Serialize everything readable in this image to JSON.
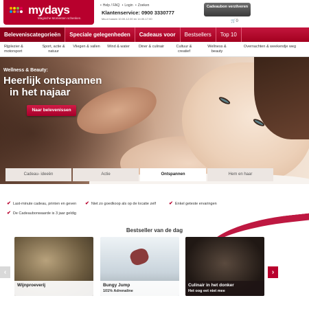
{
  "header": {
    "logo_text": "mydays",
    "logo_tagline": "Magische Momenten schenken.",
    "links": [
      "Help / FAQ",
      "Login",
      "Zoeken"
    ],
    "service_label": "Klantenservice: 0900 3330777",
    "hours": "Ma-vr tussen 10.00-12.00 en 14.00-17.00",
    "voucher_button": "Cadeaubon verzilveren",
    "cart_count": "0"
  },
  "mainnav": {
    "items": [
      {
        "label": "Beleveniscategorieën"
      },
      {
        "label": "Speciale gelegenheden"
      },
      {
        "label": "Cadeaus voor"
      },
      {
        "label": "Bestsellers"
      },
      {
        "label": "Top 10"
      }
    ]
  },
  "subnav": {
    "items": [
      {
        "label": "Rijplezier & motorsport"
      },
      {
        "label": "Sport, actie & natuur"
      },
      {
        "label": "Vliegen & vallen"
      },
      {
        "label": "Wind & water"
      },
      {
        "label": "Diner & culinair"
      },
      {
        "label": "Cultuur & creatief"
      },
      {
        "label": "Wellness & beauty"
      },
      {
        "label": "Overnachten & weekendje weg"
      }
    ]
  },
  "hero": {
    "kicker": "Wellness & Beauty:",
    "title_line1": "Heerlijk ontspannen",
    "title_line2": "in het najaar",
    "cta": "Naar belevenissen",
    "tabs": [
      {
        "label": "Cadeau- ideeën"
      },
      {
        "label": "Actie"
      },
      {
        "label": "Ontspannen"
      },
      {
        "label": "Hem en haar"
      }
    ]
  },
  "usps": [
    "Last-minute cadeau, printen en geven",
    "Niet zo goedkoop als op de locatie zelf",
    "Enkel geteste ervaringen",
    "De Cadeaubonwaarde is 3 jaar geldig"
  ],
  "bestseller": {
    "title": "Bestseller van de dag",
    "cards": [
      {
        "title": "Wijnproeverij",
        "subtitle": ""
      },
      {
        "title": "Bungy Jump",
        "subtitle": "101% Adrenaline"
      },
      {
        "title": "Culinair in het donker",
        "subtitle": "Het oog eet niet mee"
      }
    ],
    "prev_arrow": "‹",
    "next_arrow": "›"
  },
  "colors": {
    "brand": "#b8002d",
    "nav_dark": "#8c001b",
    "voucher_button": "#4a4a4a"
  },
  "icons": [
    "logo-dots-icon",
    "cart-icon",
    "check-icon",
    "chevron-left-icon",
    "chevron-right-icon"
  ]
}
